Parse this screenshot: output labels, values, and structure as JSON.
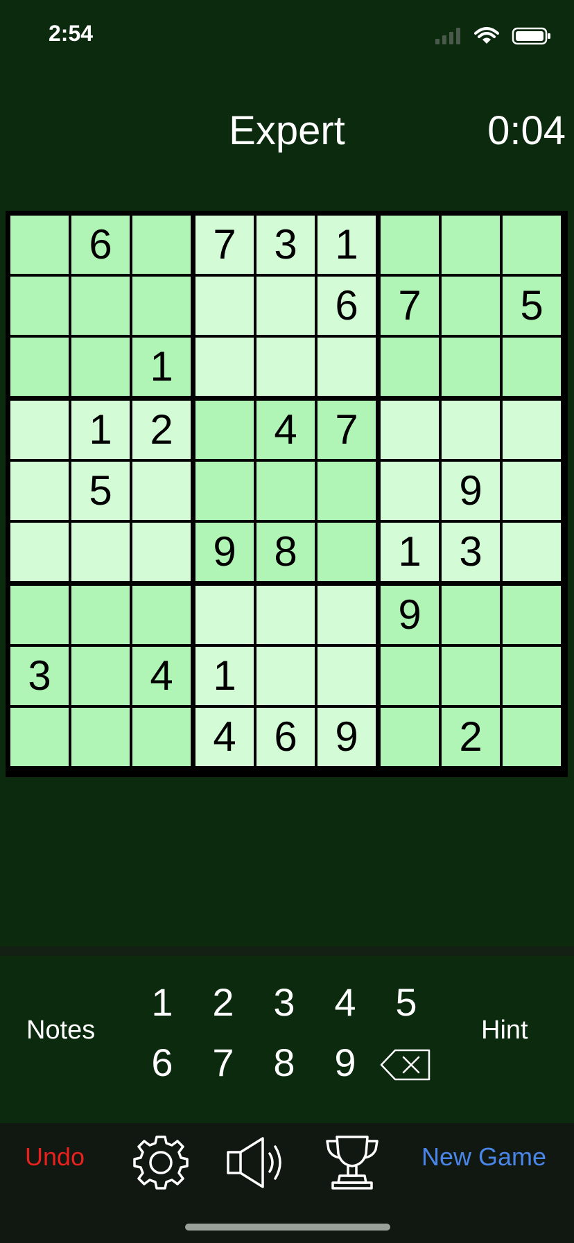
{
  "status": {
    "time": "2:54"
  },
  "header": {
    "difficulty": "Expert",
    "timer": "0:04"
  },
  "board": {
    "cells": [
      [
        "",
        "6",
        "",
        "7",
        "3",
        "1",
        "",
        "",
        ""
      ],
      [
        "",
        "",
        "",
        "",
        "",
        "6",
        "7",
        "",
        "5"
      ],
      [
        "",
        "",
        "1",
        "",
        "",
        "",
        "",
        "",
        ""
      ],
      [
        "",
        "1",
        "2",
        "",
        "4",
        "7",
        "",
        "",
        ""
      ],
      [
        "",
        "5",
        "",
        "",
        "",
        "",
        "",
        "9",
        ""
      ],
      [
        "",
        "",
        "",
        "9",
        "8",
        "",
        "1",
        "3",
        ""
      ],
      [
        "",
        "",
        "",
        "",
        "",
        "",
        "9",
        "",
        ""
      ],
      [
        "3",
        "",
        "4",
        "1",
        "",
        "",
        "",
        "",
        ""
      ],
      [
        "",
        "",
        "",
        "4",
        "6",
        "9",
        "",
        "2",
        ""
      ]
    ]
  },
  "keypad": {
    "notes_label": "Notes",
    "hint_label": "Hint",
    "digits": [
      "1",
      "2",
      "3",
      "4",
      "5",
      "6",
      "7",
      "8",
      "9"
    ]
  },
  "toolbar": {
    "undo_label": "Undo",
    "new_game_label": "New Game",
    "icons": [
      "gear-icon",
      "speaker-icon",
      "trophy-icon"
    ]
  },
  "colors": {
    "background": "#0b2a0e",
    "cell_dark": "#b0f5b5",
    "cell_light": "#d3fcd6",
    "undo": "#e8201e",
    "new_game": "#4a86e8"
  }
}
